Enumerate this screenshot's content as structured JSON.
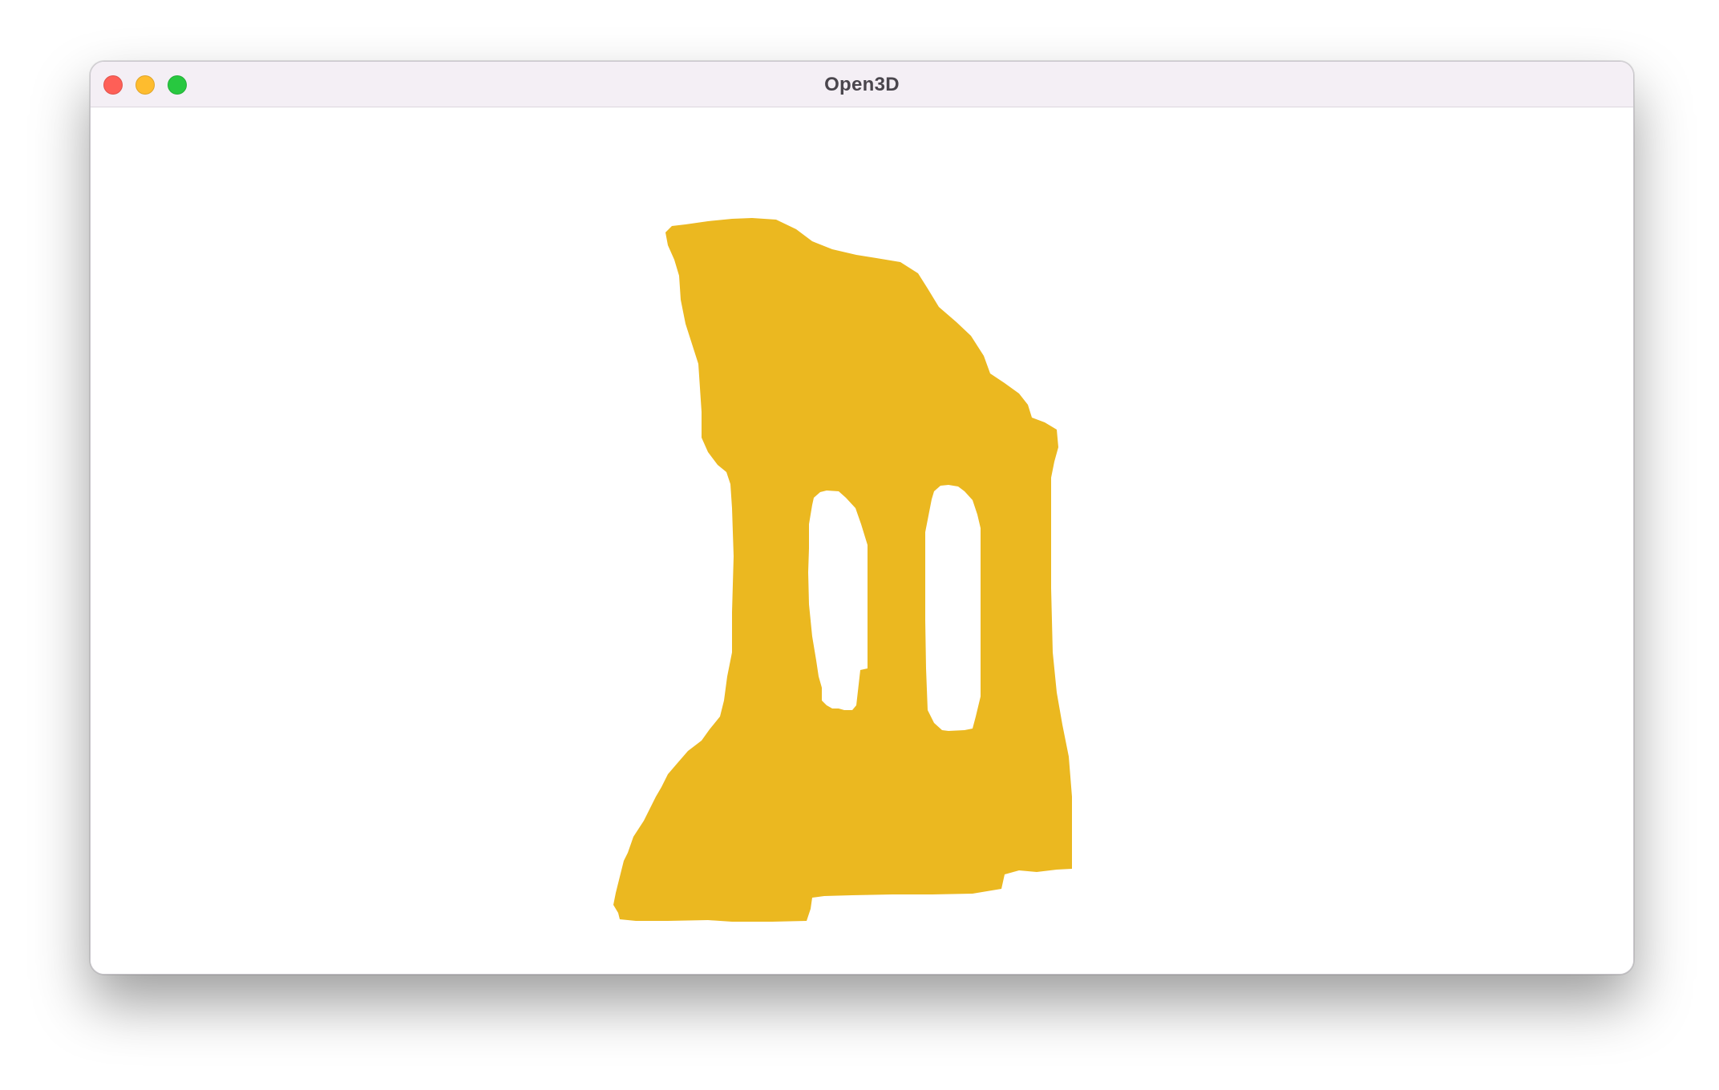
{
  "window": {
    "title": "Open3D",
    "controls": {
      "close": {
        "icon": "close-icon",
        "color": "#fe5f57"
      },
      "minimize": {
        "icon": "minimize-icon",
        "color": "#febc2e"
      },
      "zoom": {
        "icon": "zoom-icon",
        "color": "#28c840"
      }
    }
  },
  "viewport": {
    "background": "#ffffff",
    "mesh": {
      "color": "#ebb820",
      "shape": "arch-ruin"
    }
  }
}
